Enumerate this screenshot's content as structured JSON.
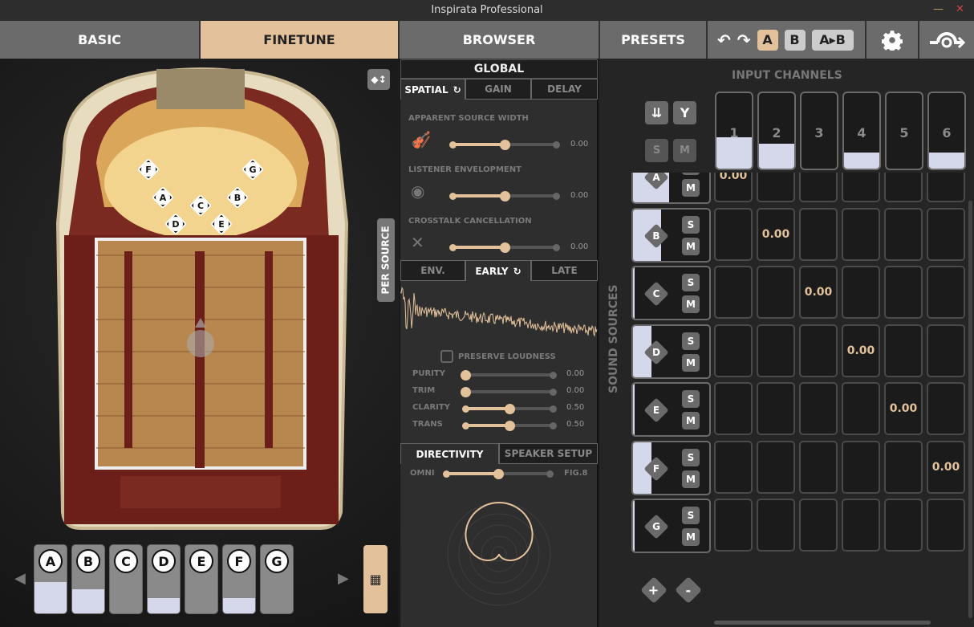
{
  "window": {
    "title": "Inspirata Professional",
    "minimize": "—",
    "close": "✕"
  },
  "tabs": [
    {
      "label": "BASIC",
      "active": false
    },
    {
      "label": "FINETUNE",
      "active": true
    },
    {
      "label": "BROWSER",
      "active": false
    },
    {
      "label": "PRESETS",
      "active": false
    }
  ],
  "toolbar": {
    "undo": "↶",
    "redo": "↷",
    "a": "A",
    "b": "B",
    "a_to_b": "A▸B",
    "settings_icon": "gear-icon",
    "bypass_icon": "bypass-icon"
  },
  "colors": {
    "accent": "#e2c19b",
    "level": "#d5d8ea"
  },
  "hall": {
    "per_source_label": "PER SOURCE",
    "sources": [
      "A",
      "B",
      "C",
      "D",
      "E",
      "F",
      "G"
    ]
  },
  "source_strip": {
    "tiles": [
      {
        "label": "A",
        "level": 0.45
      },
      {
        "label": "B",
        "level": 0.35
      },
      {
        "label": "C",
        "level": 0
      },
      {
        "label": "D",
        "level": 0.22
      },
      {
        "label": "E",
        "level": 0
      },
      {
        "label": "F",
        "level": 0.22
      },
      {
        "label": "G",
        "level": 0
      }
    ]
  },
  "global": {
    "title": "GLOBAL",
    "tabs": [
      "SPATIAL",
      "GAIN",
      "DELAY"
    ],
    "sliders": [
      {
        "label": "APPARENT SOURCE WIDTH",
        "icon": "violin-icon",
        "value": "0.00",
        "position": 0.5
      },
      {
        "label": "LISTENER ENVELOPMENT",
        "icon": "ear-icon",
        "value": "0.00",
        "position": 0.5
      },
      {
        "label": "CROSSTALK CANCELLATION",
        "icon": "crossed-arrows-icon",
        "value": "0.00",
        "position": 0.5
      }
    ]
  },
  "reverb": {
    "tabs": [
      "ENV.",
      "EARLY",
      "LATE"
    ],
    "preserve_loudness": "PRESERVE LOUDNESS",
    "preserve_checked": false,
    "sliders": [
      {
        "label": "PURITY",
        "value": "0.00",
        "position": 0
      },
      {
        "label": "TRIM",
        "value": "0.00",
        "position": 0
      },
      {
        "label": "CLARITY",
        "value": "0.50",
        "position": 0.5
      },
      {
        "label": "TRANS",
        "value": "0.50",
        "position": 0.5
      }
    ]
  },
  "directivity": {
    "tabs": [
      "DIRECTIVITY",
      "SPEAKER SETUP"
    ],
    "min_label": "OMNI",
    "max_label": "FIG.8",
    "position": 0.5
  },
  "matrix": {
    "title": "INPUT CHANNELS",
    "side_title": "SOUND SOURCES",
    "solo": "S",
    "mute": "M",
    "channels": [
      {
        "label": "1",
        "level": 0.42
      },
      {
        "label": "2",
        "level": 0.33
      },
      {
        "label": "3",
        "level": 0
      },
      {
        "label": "4",
        "level": 0.21
      },
      {
        "label": "5",
        "level": 0
      },
      {
        "label": "6",
        "level": 0.21
      }
    ],
    "sources": [
      {
        "label": "A",
        "level": 0.45
      },
      {
        "label": "B",
        "level": 0.35
      },
      {
        "label": "C",
        "level": 0
      },
      {
        "label": "D",
        "level": 0.22
      },
      {
        "label": "E",
        "level": 0
      },
      {
        "label": "F",
        "level": 0.22
      },
      {
        "label": "G",
        "level": 0
      }
    ],
    "cells": [
      [
        "0.00",
        "",
        "",
        "",
        "",
        ""
      ],
      [
        "",
        "0.00",
        "",
        "",
        "",
        ""
      ],
      [
        "",
        "",
        "0.00",
        "",
        "",
        ""
      ],
      [
        "",
        "",
        "",
        "0.00",
        "",
        ""
      ],
      [
        "",
        "",
        "",
        "",
        "0.00",
        ""
      ],
      [
        "",
        "",
        "",
        "",
        "",
        "0.00"
      ],
      [
        "",
        "",
        "",
        "",
        "",
        ""
      ]
    ],
    "add": "+",
    "remove": "-"
  }
}
